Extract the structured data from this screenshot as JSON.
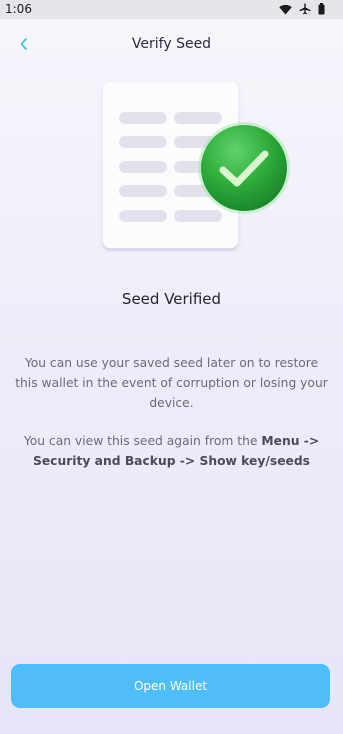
{
  "status_bar": {
    "time": "1:06",
    "icons": [
      "wifi-icon",
      "airplane-icon",
      "battery-icon"
    ]
  },
  "header": {
    "back_icon": "chevron-left-icon",
    "title": "Verify Seed"
  },
  "illustration": {
    "icons": [
      "seed-document-icon",
      "checkmark-badge-icon"
    ]
  },
  "main": {
    "heading": "Seed Verified",
    "paragraph1": "You can use your saved seed later on to restore this wallet in the event of corruption or losing your device.",
    "paragraph2_prefix": "You can view this seed again from the ",
    "paragraph2_path": "Menu -> Security and Backup -> Show key/seeds"
  },
  "footer": {
    "open_wallet_label": "Open Wallet"
  },
  "colors": {
    "accent": "#4fbdf7",
    "check_green": "#2eaa3a"
  }
}
